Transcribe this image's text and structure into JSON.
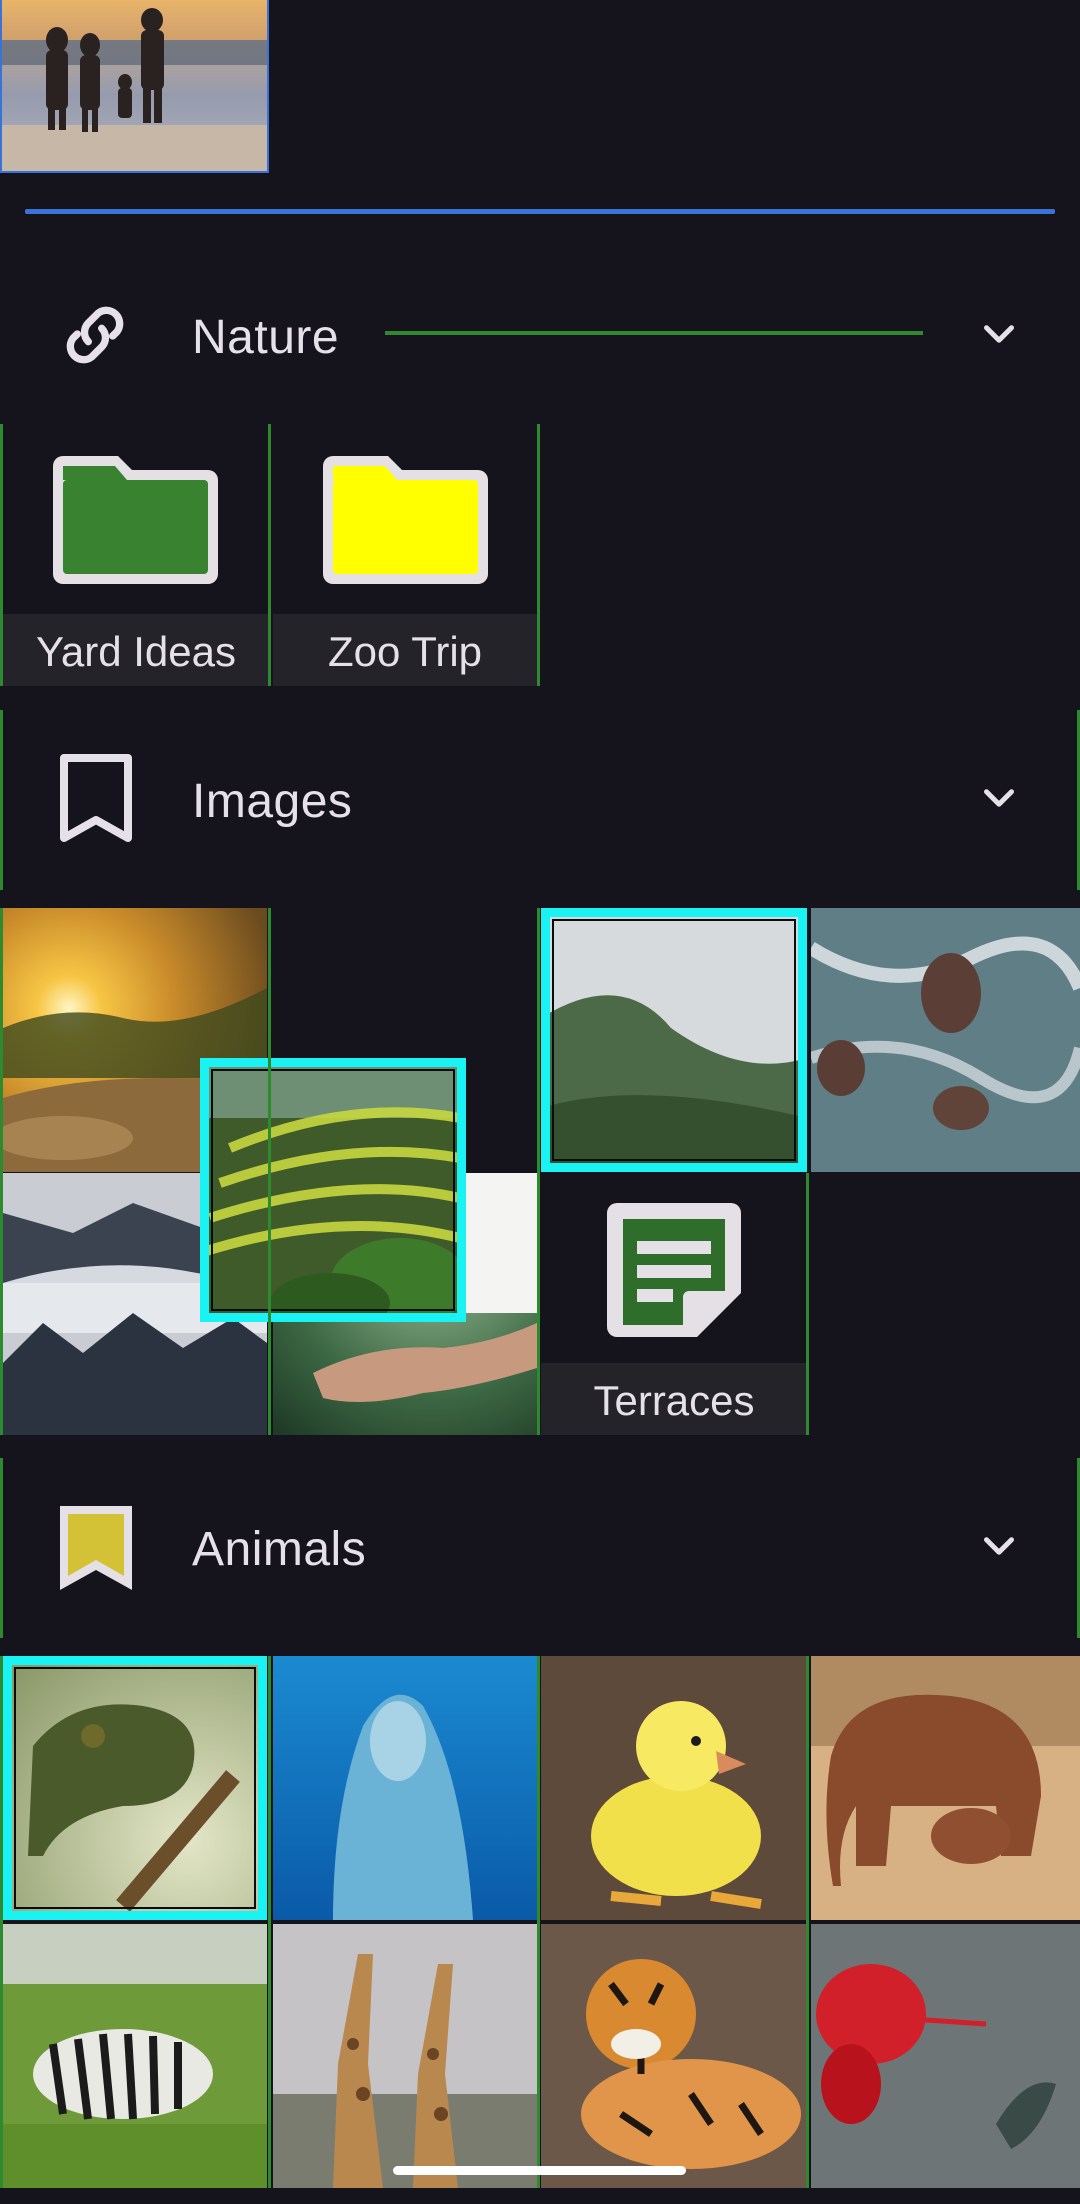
{
  "sections": [
    {
      "title": "Nature",
      "icon": "link-icon"
    },
    {
      "title": "Images",
      "icon": "bookmark-outline-icon"
    },
    {
      "title": "Animals",
      "icon": "bookmark-filled-icon",
      "icon_color": "#d4c236"
    }
  ],
  "folders": [
    {
      "label": "Yard Ideas",
      "color": "#39822f"
    },
    {
      "label": "Zoo Trip",
      "color": "#ffff00"
    }
  ],
  "note": {
    "label": "Terraces",
    "color": "#2f6e2a"
  },
  "colors": {
    "selection": "#19f3f3",
    "accent_blue": "#3a73d8",
    "group_green": "#2e8a2e",
    "background": "#15131c"
  }
}
